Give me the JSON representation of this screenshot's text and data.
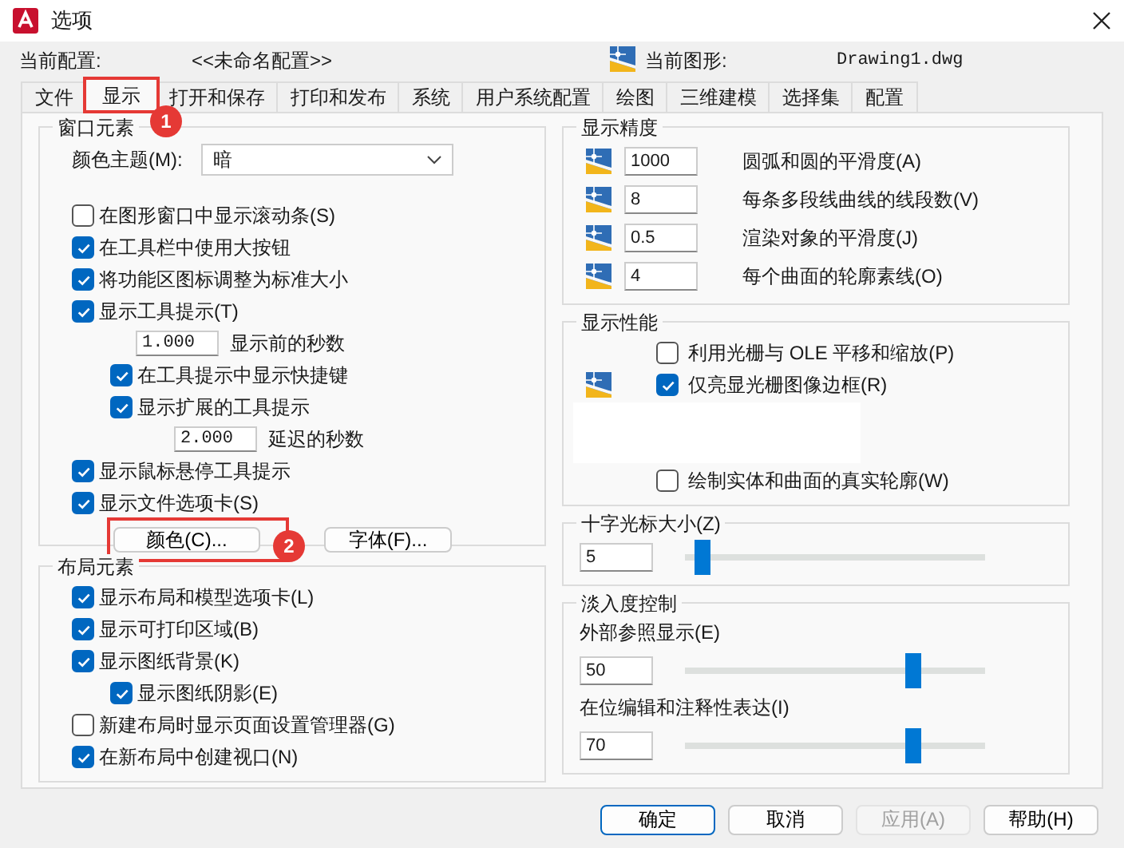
{
  "window": {
    "title": "选项"
  },
  "profile": {
    "label": "当前配置:",
    "value": "<<未命名配置>>"
  },
  "drawing": {
    "label": "当前图形:",
    "value": "Drawing1.dwg"
  },
  "tabs": [
    {
      "label": "文件",
      "selected": false
    },
    {
      "label": "显示",
      "selected": true,
      "annotation": "1"
    },
    {
      "label": "打开和保存",
      "selected": false
    },
    {
      "label": "打印和发布",
      "selected": false
    },
    {
      "label": "系统",
      "selected": false
    },
    {
      "label": "用户系统配置",
      "selected": false
    },
    {
      "label": "绘图",
      "selected": false
    },
    {
      "label": "三维建模",
      "selected": false
    },
    {
      "label": "选择集",
      "selected": false
    },
    {
      "label": "配置",
      "selected": false
    }
  ],
  "window_elements": {
    "title": "窗口元素",
    "color_theme": {
      "label": "颜色主题(M):",
      "value": "暗"
    },
    "items": [
      {
        "kind": "checkbox",
        "label": "在图形窗口中显示滚动条(S)",
        "checked": false
      },
      {
        "kind": "checkbox",
        "label": "在工具栏中使用大按钮",
        "checked": true
      },
      {
        "kind": "checkbox",
        "label": "将功能区图标调整为标准大小",
        "checked": true
      },
      {
        "kind": "checkbox",
        "label": "显示工具提示(T)",
        "checked": true,
        "children": [
          {
            "kind": "number",
            "value": "1.000",
            "label": "显示前的秒数"
          },
          {
            "kind": "checkbox",
            "label": "在工具提示中显示快捷键",
            "checked": true
          },
          {
            "kind": "checkbox",
            "label": "显示扩展的工具提示",
            "checked": true,
            "children": [
              {
                "kind": "number",
                "value": "2.000",
                "label": "延迟的秒数"
              }
            ]
          }
        ]
      },
      {
        "kind": "checkbox",
        "label": "显示鼠标悬停工具提示",
        "checked": true
      },
      {
        "kind": "checkbox",
        "label": "显示文件选项卡(S)",
        "checked": true
      }
    ],
    "buttons": [
      {
        "label": "颜色(C)...",
        "annotation": "2"
      },
      {
        "label": "字体(F)..."
      }
    ]
  },
  "layout_elements": {
    "title": "布局元素",
    "items": [
      {
        "kind": "checkbox",
        "label": "显示布局和模型选项卡(L)",
        "checked": true
      },
      {
        "kind": "checkbox",
        "label": "显示可打印区域(B)",
        "checked": true
      },
      {
        "kind": "checkbox",
        "label": "显示图纸背景(K)",
        "checked": true,
        "children": [
          {
            "kind": "checkbox",
            "label": "显示图纸阴影(E)",
            "checked": true
          }
        ]
      },
      {
        "kind": "checkbox",
        "label": "新建布局时显示页面设置管理器(G)",
        "checked": false
      },
      {
        "kind": "checkbox",
        "label": "在新布局中创建视口(N)",
        "checked": true
      }
    ]
  },
  "display_precision": {
    "title": "显示精度",
    "rows": [
      {
        "value": "1000",
        "label": "圆弧和圆的平滑度(A)"
      },
      {
        "value": "8",
        "label": "每条多段线曲线的线段数(V)"
      },
      {
        "value": "0.5",
        "label": "渲染对象的平滑度(J)"
      },
      {
        "value": "4",
        "label": "每个曲面的轮廓素线(O)"
      }
    ]
  },
  "display_performance": {
    "title": "显示性能",
    "items": [
      {
        "kind": "checkbox",
        "label": "利用光栅与 OLE 平移和缩放(P)",
        "checked": false,
        "icon": false
      },
      {
        "kind": "checkbox",
        "label": "仅亮显光栅图像边框(R)",
        "checked": true,
        "icon": true
      },
      {
        "kind": "blank"
      },
      {
        "kind": "checkbox",
        "label": "绘制实体和曲面的真实轮廓(W)",
        "checked": false,
        "icon": false
      }
    ]
  },
  "crosshair_size": {
    "title": "十字光标大小(Z)",
    "value": "5",
    "level": 0.06
  },
  "fade_control": {
    "title": "淡入度控制",
    "items": [
      {
        "label": "外部参照显示(E)",
        "value": "50",
        "level": 0.76
      },
      {
        "label": "在位编辑和注释性表达(I)",
        "value": "70",
        "level": 0.76
      }
    ]
  },
  "footer_buttons": [
    {
      "label": "确定",
      "primary": true,
      "disabled": false
    },
    {
      "label": "取消",
      "primary": false,
      "disabled": false
    },
    {
      "label": "应用(A)",
      "primary": false,
      "disabled": true
    },
    {
      "label": "帮助(H)",
      "primary": false,
      "disabled": false
    }
  ]
}
